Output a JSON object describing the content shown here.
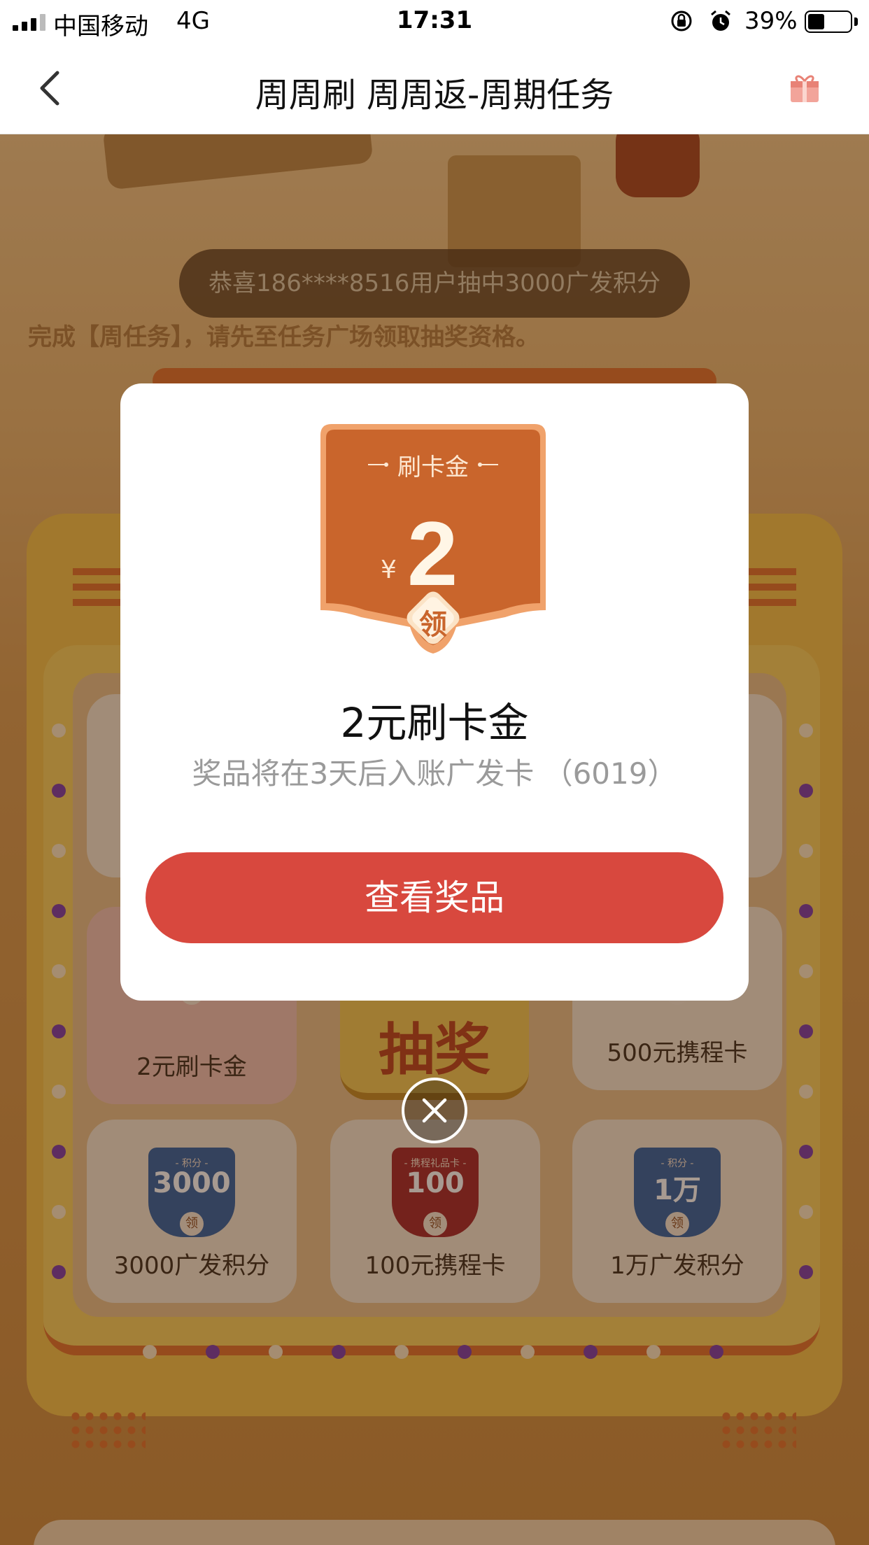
{
  "status_bar": {
    "carrier": "中国移动",
    "network": "4G",
    "time": "17:31",
    "battery_percent": "39%",
    "battery_level": 0.39,
    "icons": [
      "signal-icon",
      "orientation-lock-icon",
      "alarm-icon",
      "battery-icon"
    ]
  },
  "nav": {
    "title": "周周刷 周周返-周期任务",
    "back_icon": "chevron-left-icon",
    "gift_icon": "gift-icon"
  },
  "background": {
    "ticker": "恭喜186****8516用户抽中3000广发积分",
    "hint": "完成【周任务】，请先至任务广场领取抽奖资格。",
    "draw_label": "抽奖",
    "grid_items": [
      {
        "label": "2元刷卡金"
      },
      {
        "label": "500元携程卡"
      },
      {
        "label": "3000广发积分",
        "badge_tag": "- 积分 -",
        "badge_amount": "3000",
        "badge_action": "领",
        "color": "#2f5fa0"
      },
      {
        "label": "100元携程卡",
        "badge_tag": "- 携程礼品卡 -",
        "badge_amount": "100",
        "badge_currency": "¥",
        "badge_action": "领",
        "color": "#a3262a"
      },
      {
        "label": "1万广发积分",
        "badge_tag": "- 积分 -",
        "badge_amount": "1万",
        "badge_action": "领",
        "color": "#2f5fa0"
      }
    ]
  },
  "modal": {
    "badge": {
      "tag": "刷卡金",
      "currency": "¥",
      "amount": "2",
      "action": "领",
      "color": "#c9652c"
    },
    "prize_name": "2元刷卡金",
    "prize_desc": "奖品将在3天后入账广发卡 （6019）",
    "button_label": "查看奖品",
    "button_color": "#d8483e",
    "close_icon": "close-icon"
  }
}
